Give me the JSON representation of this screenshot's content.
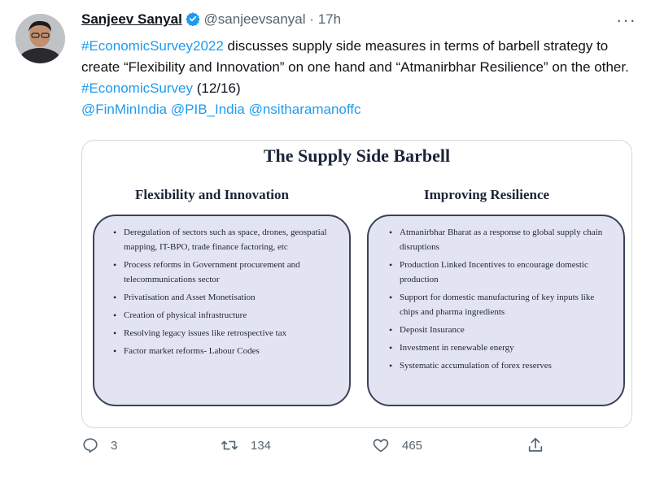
{
  "tweet": {
    "author_name": "Sanjeev Sanyal",
    "handle": "@sanjeevsanyal",
    "separator": "·",
    "time": "17h",
    "more": "···",
    "text": {
      "part1_link": "#EconomicSurvey2022",
      "part2": " discusses supply side measures in terms of barbell strategy to create “Flexibility and Innovation” on one hand and “Atmanirbhar Resilience” on the other. ",
      "part3_link": "#EconomicSurvey",
      "part4": "  (12/16)",
      "mentions": [
        "@FinMinIndia",
        "@PIB_India",
        "@nsitharamanoffc"
      ]
    }
  },
  "image": {
    "title": "The Supply Side Barbell",
    "left": {
      "heading": "Flexibility and Innovation",
      "items": [
        "Deregulation of sectors such as space, drones, geospatial mapping, IT-BPO, trade finance factoring, etc",
        "Process reforms in Government procurement and telecommunications sector",
        "Privatisation and Asset Monetisation",
        "Creation of physical infrastructure",
        "Resolving legacy issues like retrospective tax",
        "Factor market reforms- Labour Codes"
      ]
    },
    "right": {
      "heading": "Improving Resilience",
      "items": [
        "Atmanirbhar Bharat as a response to global supply chain disruptions",
        "Production Linked Incentives to encourage domestic production",
        "Support for domestic manufacturing of key inputs like chips and pharma ingredients",
        "Deposit Insurance",
        "Investment in renewable energy",
        "Systematic accumulation of forex reserves"
      ]
    }
  },
  "actions": {
    "replies": "3",
    "retweets": "134",
    "likes": "465"
  },
  "colors": {
    "link": "#1d9bf0",
    "verified": "#1d9bf0",
    "muted": "#536471",
    "card_fill": "#e3e4f2"
  }
}
